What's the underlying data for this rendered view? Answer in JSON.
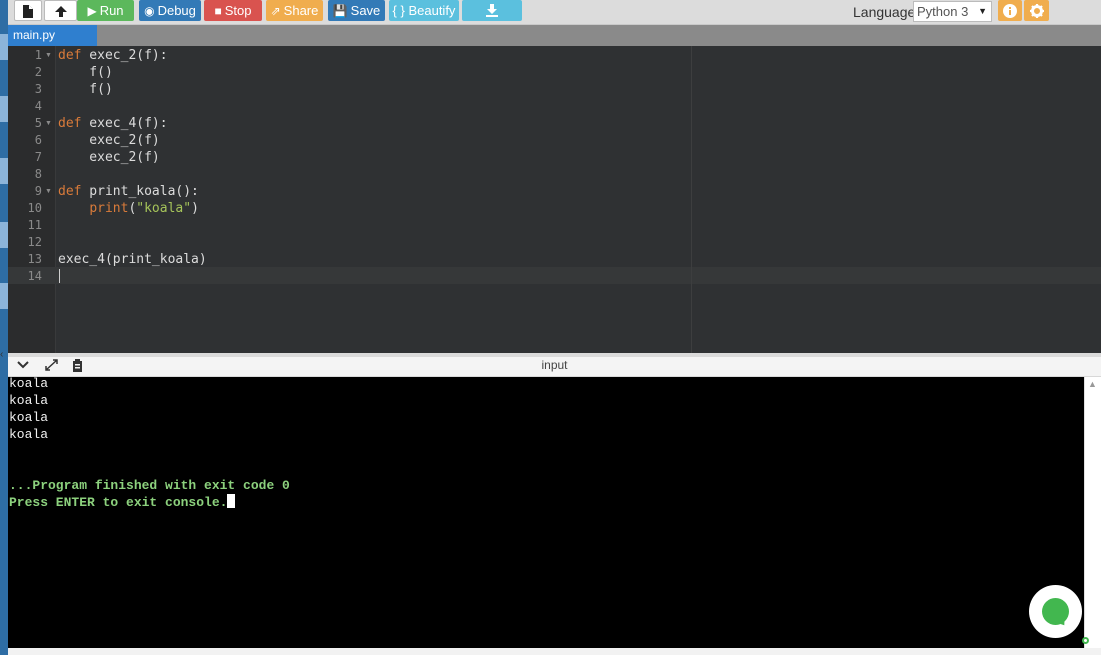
{
  "toolbar": {
    "new_icon": "file-icon",
    "upload_icon": "upload-icon",
    "run_label": "Run",
    "debug_label": "Debug",
    "stop_label": "Stop",
    "share_label": "Share",
    "save_label": "Save",
    "beautify_label": "{ } Beautify",
    "download_icon": "download-icon",
    "language_label": "Language",
    "language_value": "Python 3",
    "info_icon": "info-icon",
    "settings_icon": "gear-icon"
  },
  "tabs": [
    {
      "label": "main.py",
      "active": true
    }
  ],
  "editor": {
    "line_numbers": [
      "1",
      "2",
      "3",
      "4",
      "5",
      "6",
      "7",
      "8",
      "9",
      "10",
      "11",
      "12",
      "13",
      "14"
    ],
    "code": [
      "def exec_2(f):",
      "    f()",
      "    f()",
      "",
      "def exec_4(f):",
      "    exec_2(f)",
      "    exec_2(f)",
      "",
      "def print_koala():",
      "    print(\"koala\")",
      "",
      "",
      "exec_4(print_koala)",
      ""
    ],
    "active_line": 14
  },
  "console": {
    "title": "input",
    "output": [
      "koala",
      "koala",
      "koala",
      "koala",
      "",
      ""
    ],
    "finished_message": "...Program finished with exit code 0",
    "prompt_message": "Press ENTER to exit console."
  },
  "colors": {
    "run": "#5cb85c",
    "debug": "#337ab7",
    "stop": "#d9534f",
    "share": "#f0ad4e",
    "save": "#337ab7",
    "beautify": "#5bc0de",
    "editor_bg": "#2f3133",
    "keyword": "#d97b3a",
    "string": "#a6c45a",
    "console_green": "#8cd17d",
    "chat": "#42b74f"
  }
}
